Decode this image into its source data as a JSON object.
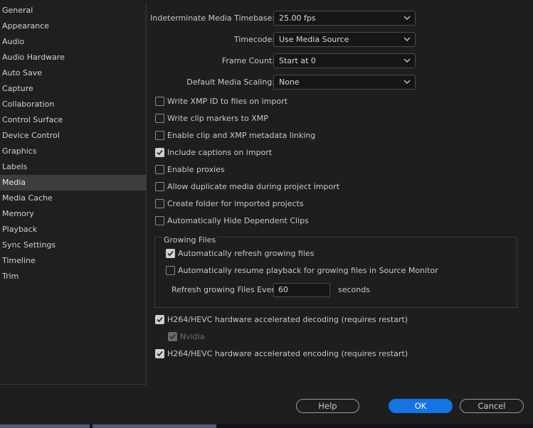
{
  "sidebar": {
    "items": [
      {
        "label": "General"
      },
      {
        "label": "Appearance"
      },
      {
        "label": "Audio"
      },
      {
        "label": "Audio Hardware"
      },
      {
        "label": "Auto Save"
      },
      {
        "label": "Capture"
      },
      {
        "label": "Collaboration"
      },
      {
        "label": "Control Surface"
      },
      {
        "label": "Device Control"
      },
      {
        "label": "Graphics"
      },
      {
        "label": "Labels"
      },
      {
        "label": "Media",
        "selected": true
      },
      {
        "label": "Media Cache"
      },
      {
        "label": "Memory"
      },
      {
        "label": "Playback"
      },
      {
        "label": "Sync Settings"
      },
      {
        "label": "Timeline"
      },
      {
        "label": "Trim"
      }
    ]
  },
  "fields": {
    "timebase": {
      "label": "Indeterminate Media Timebase:",
      "value": "25.00 fps"
    },
    "timecode": {
      "label": "Timecode:",
      "value": "Use Media Source"
    },
    "frame_count": {
      "label": "Frame Count:",
      "value": "Start at 0"
    },
    "scaling": {
      "label": "Default Media Scaling:",
      "value": "None"
    }
  },
  "checkboxes": {
    "xmp_id": {
      "label": "Write XMP ID to files on import",
      "checked": false
    },
    "clip_markers": {
      "label": "Write clip markers to XMP",
      "checked": false
    },
    "metadata_linking": {
      "label": "Enable clip and XMP metadata linking",
      "checked": false
    },
    "captions": {
      "label": "Include captions on import",
      "checked": true
    },
    "proxies": {
      "label": "Enable proxies",
      "checked": false
    },
    "duplicate_media": {
      "label": "Allow duplicate media during project import",
      "checked": false
    },
    "create_folder": {
      "label": "Create folder for imported projects",
      "checked": false
    },
    "hide_dependent": {
      "label": "Automatically Hide Dependent Clips",
      "checked": false
    }
  },
  "growing_files": {
    "title": "Growing Files",
    "auto_refresh": {
      "label": "Automatically refresh growing files",
      "checked": true
    },
    "auto_resume": {
      "label": "Automatically resume playback for growing files in Source Monitor",
      "checked": false
    },
    "refresh_label": "Refresh growing Files Every",
    "refresh_value": "60",
    "refresh_unit": "seconds"
  },
  "hardware": {
    "decoding": {
      "label": "H264/HEVC hardware accelerated decoding (requires restart)",
      "checked": true
    },
    "nvidia": {
      "label": "Nvidia",
      "checked": true,
      "disabled": true
    },
    "encoding": {
      "label": "H264/HEVC hardware accelerated encoding (requires restart)",
      "checked": true
    }
  },
  "buttons": {
    "help": "Help",
    "ok": "OK",
    "cancel": "Cancel"
  },
  "colors": {
    "accent": "#1473e6",
    "background": "#1e1e1e",
    "selected": "#3d3d3d"
  }
}
